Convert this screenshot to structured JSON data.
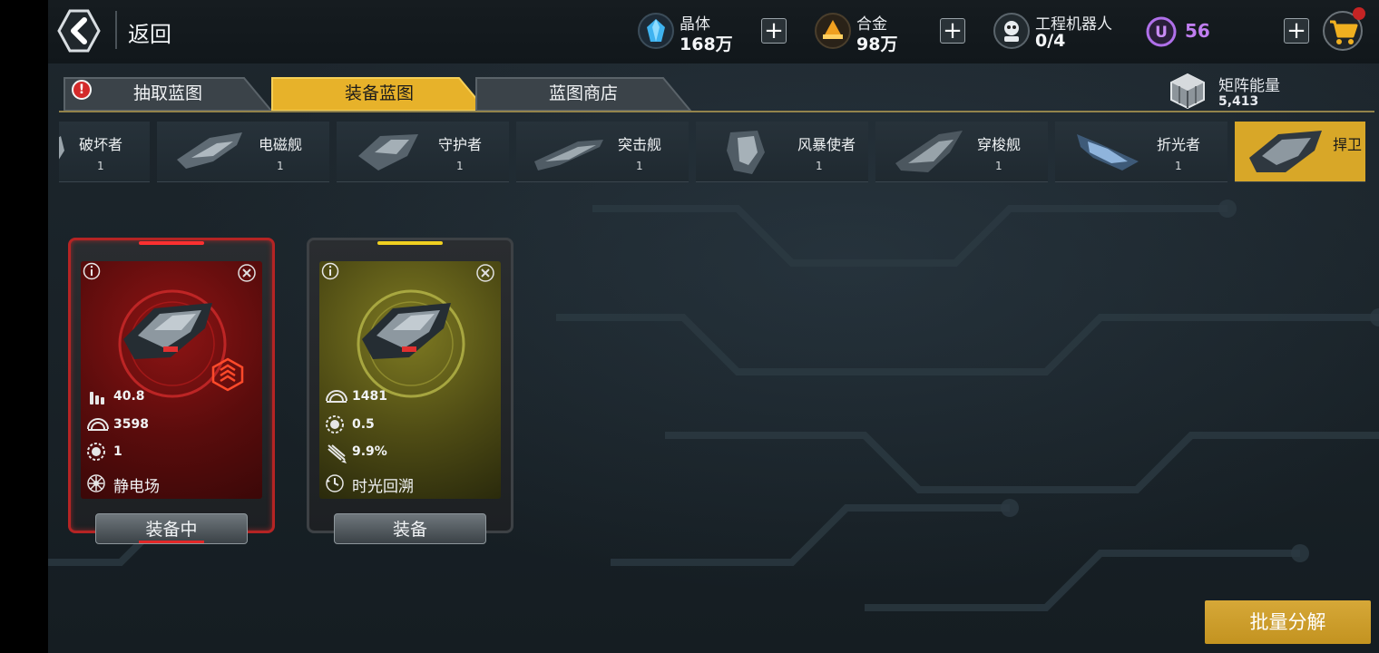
{
  "topbar": {
    "back_label": "返回",
    "resources": [
      {
        "name": "晶体",
        "value": "168万",
        "icon": "crystal-icon"
      },
      {
        "name": "合金",
        "value": "98万",
        "icon": "alloy-icon"
      },
      {
        "name": "工程机器人",
        "value": "0/4",
        "icon": "robot-icon"
      }
    ],
    "u_currency": {
      "icon": "u-coin-icon",
      "value": "56"
    },
    "shop_icon": "cart-icon"
  },
  "tabs": [
    {
      "label": "抽取蓝图",
      "has_badge": true,
      "badge_text": "!"
    },
    {
      "label": "装备蓝图",
      "active": true
    },
    {
      "label": "蓝图商店"
    }
  ],
  "matrix_energy": {
    "name": "矩阵能量",
    "value": "5,413"
  },
  "ships": [
    {
      "name": "破坏者",
      "count": "1"
    },
    {
      "name": "电磁舰",
      "count": "1"
    },
    {
      "name": "守护者",
      "count": "1"
    },
    {
      "name": "突击舰",
      "count": "1"
    },
    {
      "name": "风暴使者",
      "count": "1"
    },
    {
      "name": "穿梭舰",
      "count": "1"
    },
    {
      "name": "折光者",
      "count": "1"
    },
    {
      "name": "捍卫",
      "count": "",
      "active": true
    }
  ],
  "cards": [
    {
      "theme": "red",
      "stats": [
        {
          "icon": "ammo-icon",
          "value": "40.8"
        },
        {
          "icon": "shield-dome-icon",
          "value": "3598"
        },
        {
          "icon": "gear-core-icon",
          "value": "1"
        }
      ],
      "skill": {
        "icon": "static-field-icon",
        "name": "静电场"
      },
      "rank_icon": "rank-chevron-icon",
      "button": "装备中"
    },
    {
      "theme": "yellow",
      "stats": [
        {
          "icon": "shield-dome-icon",
          "value": "1481"
        },
        {
          "icon": "gear-core-icon",
          "value": "0.5"
        },
        {
          "icon": "missile-icon",
          "value": "9.9%"
        }
      ],
      "skill": {
        "icon": "time-rewind-icon",
        "name": "时光回溯"
      },
      "button": "装备"
    }
  ],
  "bulk_button": "批量分解",
  "colors": {
    "accent_gold": "#d8a728",
    "red_theme": "#b01c1c",
    "yellow_theme": "#8a8a22",
    "u_purple": "#c07ef0"
  }
}
